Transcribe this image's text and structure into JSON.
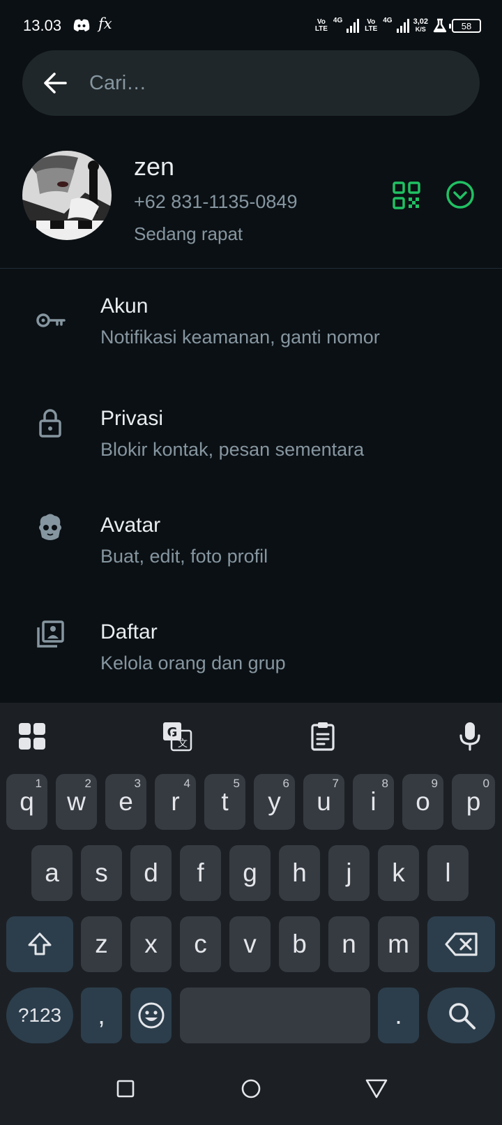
{
  "status_bar": {
    "time": "13.03",
    "app_icons": [
      "discord-icon",
      "fx-icon"
    ],
    "fx_label": "fx",
    "volte_top": "Vo",
    "volte_bottom": "LTE",
    "network1": "4G",
    "network2": "4G",
    "speed_value": "3,02",
    "speed_unit": "K/S",
    "battery": "58"
  },
  "search": {
    "placeholder": "Cari…"
  },
  "profile": {
    "name": "zen",
    "phone": "+62 831-1135-0849",
    "status": "Sedang rapat"
  },
  "settings": [
    {
      "icon": "key-icon",
      "title": "Akun",
      "subtitle": "Notifikasi keamanan, ganti nomor"
    },
    {
      "icon": "lock-icon",
      "title": "Privasi",
      "subtitle": "Blokir kontak, pesan sementara"
    },
    {
      "icon": "avatar-face-icon",
      "title": "Avatar",
      "subtitle": "Buat, edit, foto profil"
    },
    {
      "icon": "list-contacts-icon",
      "title": "Daftar",
      "subtitle": "Kelola orang dan grup"
    }
  ],
  "keyboard": {
    "toolbar": [
      "apps-grid-icon",
      "translate-icon",
      "clipboard-icon",
      "mic-icon"
    ],
    "row1": [
      {
        "k": "q",
        "h": "1"
      },
      {
        "k": "w",
        "h": "2"
      },
      {
        "k": "e",
        "h": "3"
      },
      {
        "k": "r",
        "h": "4"
      },
      {
        "k": "t",
        "h": "5"
      },
      {
        "k": "y",
        "h": "6"
      },
      {
        "k": "u",
        "h": "7"
      },
      {
        "k": "i",
        "h": "8"
      },
      {
        "k": "o",
        "h": "9"
      },
      {
        "k": "p",
        "h": "0"
      }
    ],
    "row2": [
      "a",
      "s",
      "d",
      "f",
      "g",
      "h",
      "j",
      "k",
      "l"
    ],
    "row3": [
      "z",
      "x",
      "c",
      "v",
      "b",
      "n",
      "m"
    ],
    "symbols_label": "?123",
    "comma": ",",
    "period": "."
  },
  "colors": {
    "background": "#0b1014",
    "accent_green": "#21c063",
    "secondary_text": "#8696a0",
    "key_bg": "#363b42",
    "modifier_key_bg": "#2c3e4c"
  }
}
